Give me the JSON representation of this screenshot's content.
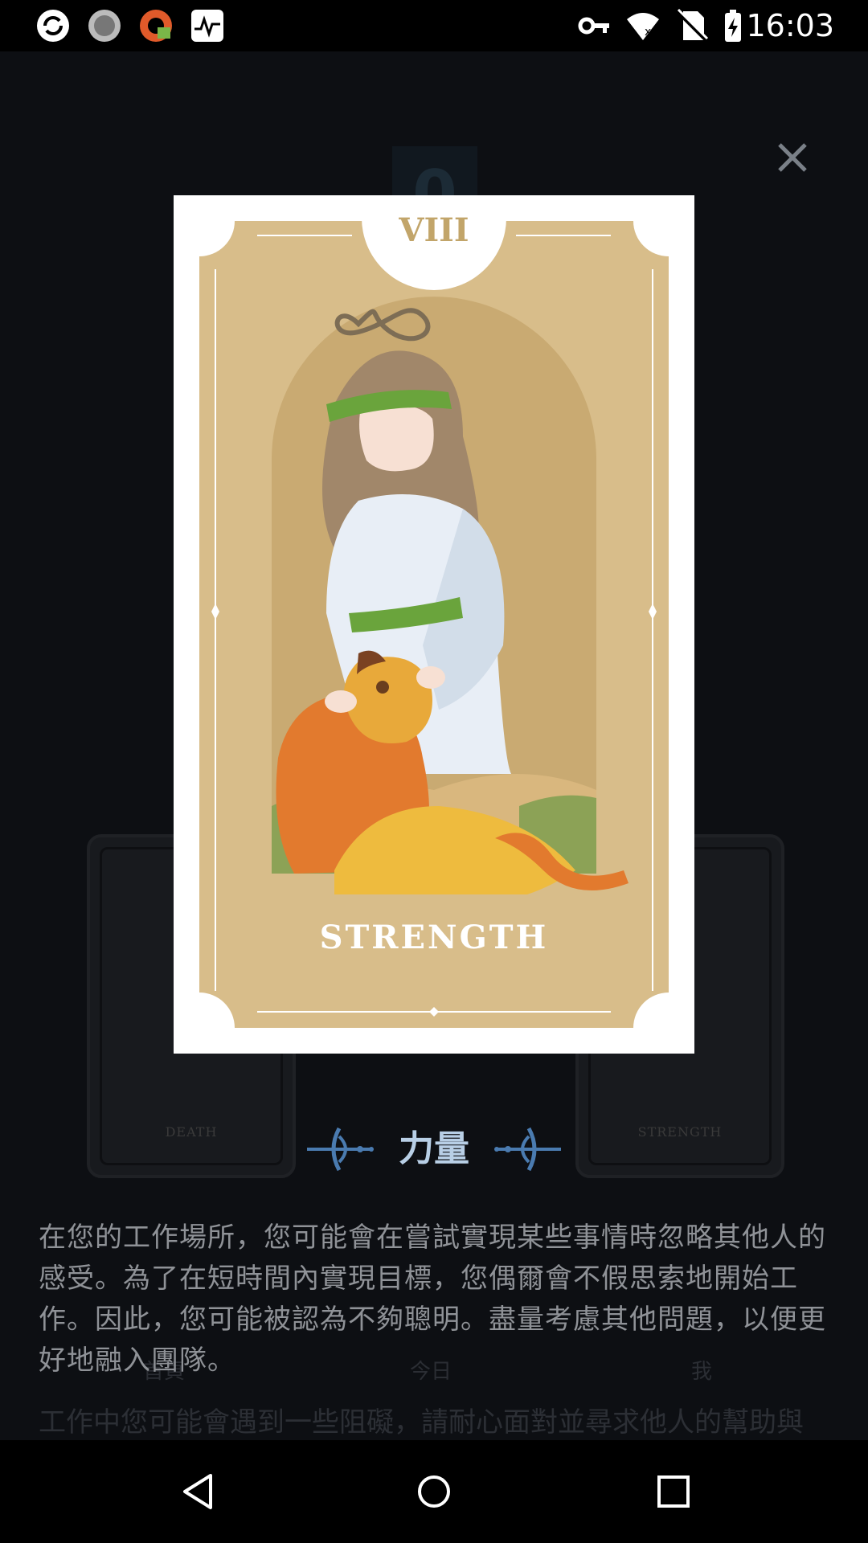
{
  "status_bar": {
    "time": "16:03",
    "left_icons": [
      "sync-app-icon",
      "loading-app-icon",
      "vpn-app-icon",
      "activity-app-icon"
    ],
    "right_icons": [
      "vpn-key-icon",
      "wifi-icon",
      "no-sim-icon",
      "battery-charging-icon"
    ]
  },
  "background": {
    "counter": "0",
    "left_card_label": "DEATH",
    "right_card_label": "STRENGTH",
    "tabs": [
      "首頁",
      "今日",
      "我"
    ]
  },
  "card": {
    "numeral": "VIII",
    "name": "STRENGTH",
    "colors": {
      "frame": "#d8bd8a",
      "arch": "#c9aa72",
      "lion": "#e27a2e",
      "robe": "#e8eef6",
      "band": "#6aa43c"
    }
  },
  "title": "力量",
  "description": "在您的工作場所，您可能會在嘗試實現某些事情時忽略其他人的感受。為了在短時間內實現目標，您偶爾會不假思索地開始工作。因此，您可能被認為不夠聰明。盡量考慮其他問題，以便更好地融入團隊。",
  "description_overflow": "工作中您可能會遇到一些阻礙，請耐心面對並尋求他人的幫助與支持。",
  "accent_color": "#4a7bb0",
  "nav": {
    "back": "back-icon",
    "home": "home-icon",
    "recents": "recents-icon"
  }
}
